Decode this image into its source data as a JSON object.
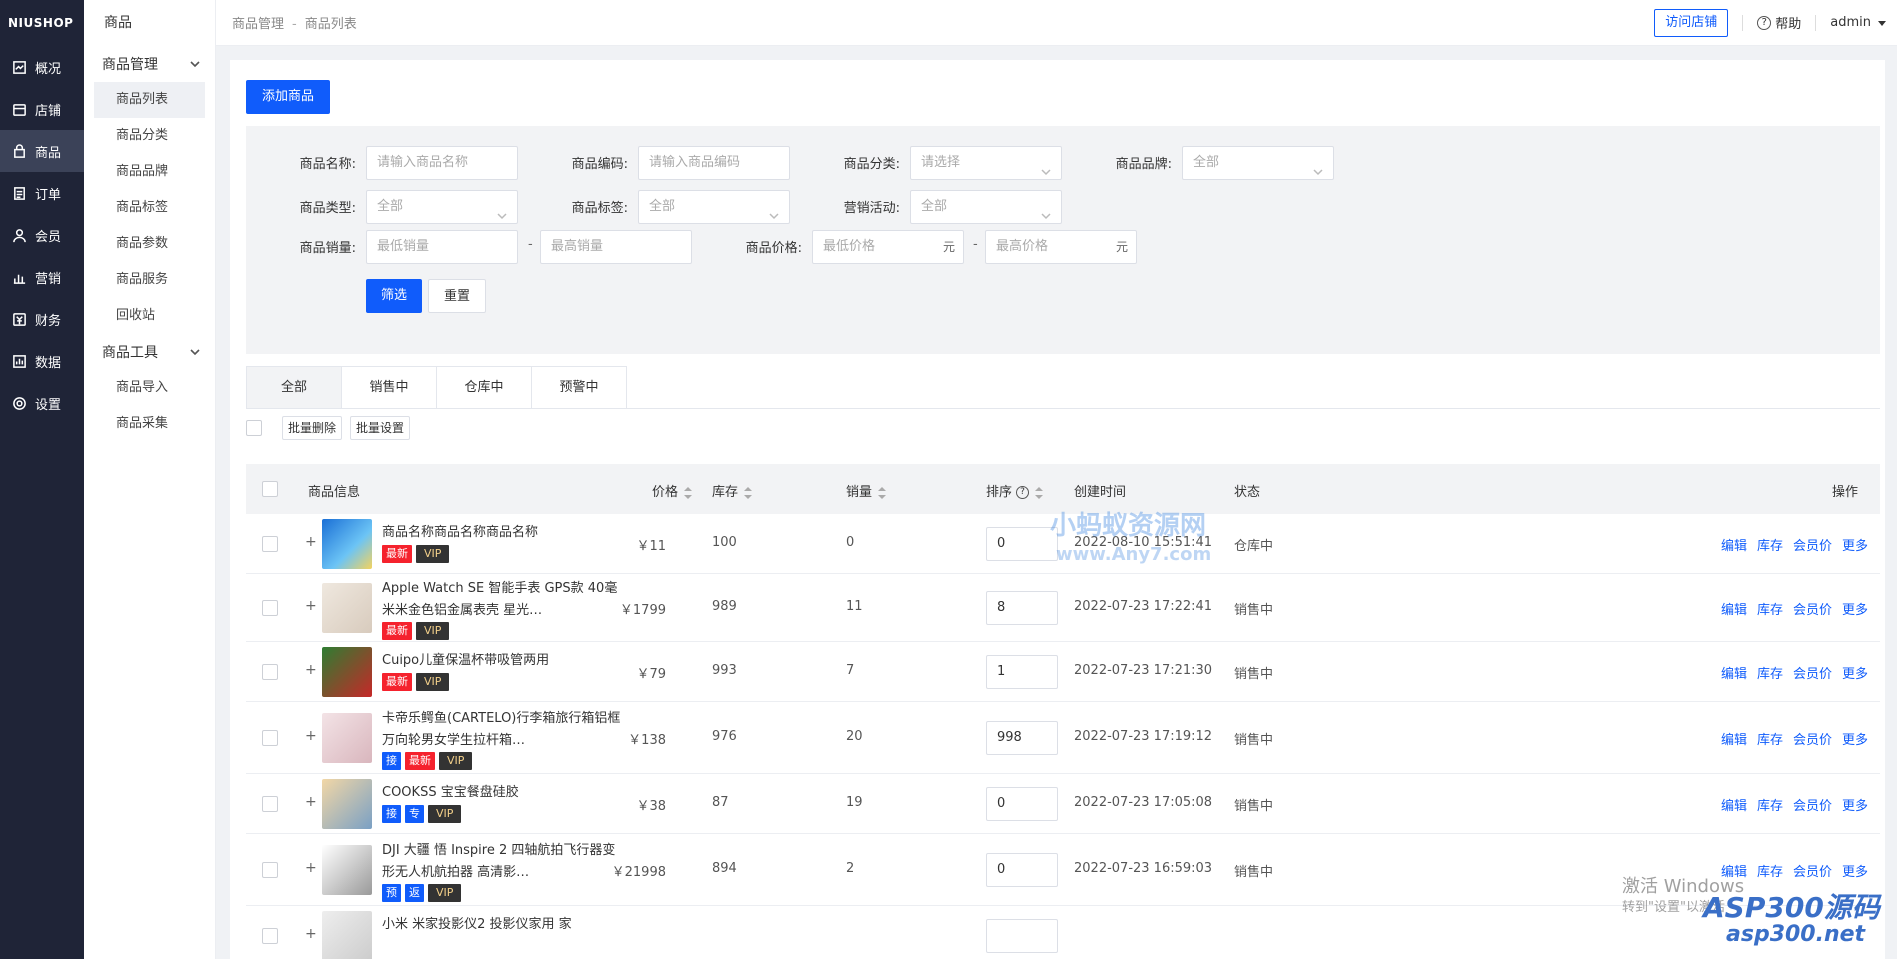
{
  "app": {
    "logo": "NIUSHOP"
  },
  "sidebar": {
    "items": [
      {
        "label": "概况",
        "icon": "dashboard-icon"
      },
      {
        "label": "店铺",
        "icon": "store-icon"
      },
      {
        "label": "商品",
        "icon": "goods-icon",
        "active": true
      },
      {
        "label": "订单",
        "icon": "order-icon"
      },
      {
        "label": "会员",
        "icon": "member-icon"
      },
      {
        "label": "营销",
        "icon": "marketing-icon"
      },
      {
        "label": "财务",
        "icon": "finance-icon"
      },
      {
        "label": "数据",
        "icon": "data-icon"
      },
      {
        "label": "设置",
        "icon": "settings-icon"
      }
    ]
  },
  "subnav": {
    "title": "商品",
    "group1": "商品管理",
    "group1_items": [
      "商品列表",
      "商品分类",
      "商品品牌",
      "商品标签",
      "商品参数",
      "商品服务",
      "回收站"
    ],
    "group2": "商品工具",
    "group2_items": [
      "商品导入",
      "商品采集"
    ]
  },
  "topbar": {
    "breadcrumb": [
      "商品管理",
      "商品列表"
    ],
    "breadcrumb_sep": "-",
    "visit_store": "访问店铺",
    "help": "帮助",
    "user": "admin"
  },
  "toolbar": {
    "add_goods": "添加商品"
  },
  "filter": {
    "name_label": "商品名称:",
    "name_placeholder": "请输入商品名称",
    "code_label": "商品编码:",
    "code_placeholder": "请输入商品编码",
    "category_label": "商品分类:",
    "category_value": "请选择",
    "brand_label": "商品品牌:",
    "brand_value": "全部",
    "type_label": "商品类型:",
    "type_value": "全部",
    "tag_label": "商品标签:",
    "tag_value": "全部",
    "promo_label": "营销活动:",
    "promo_value": "全部",
    "sales_label": "商品销量:",
    "sales_min": "最低销量",
    "sales_max": "最高销量",
    "price_label": "商品价格:",
    "price_min": "最低价格",
    "price_max": "最高价格",
    "unit": "元",
    "range_sep": "-",
    "submit": "筛选",
    "reset": "重置"
  },
  "tabs": [
    "全部",
    "销售中",
    "仓库中",
    "预警中"
  ],
  "batch": {
    "delete": "批量删除",
    "settings": "批量设置"
  },
  "table": {
    "headers": {
      "info": "商品信息",
      "price": "价格",
      "stock": "库存",
      "sales": "销量",
      "sort": "排序",
      "created": "创建时间",
      "status": "状态",
      "ops": "操作"
    },
    "ops": [
      "编辑",
      "库存",
      "会员价",
      "更多"
    ],
    "rows": [
      {
        "name": "商品名称商品名称商品名称",
        "badges": [
          "最新",
          "VIP"
        ],
        "price": "￥11",
        "stock": "100",
        "sales": "0",
        "sort": "0",
        "created": "2022-08-10 15:51:41",
        "status": "仓库中"
      },
      {
        "name": "Apple Watch SE 智能手表 GPS款 40毫米米金色铝金属表壳 星光…",
        "badges": [
          "最新",
          "VIP"
        ],
        "price": "￥1799",
        "stock": "989",
        "sales": "11",
        "sort": "8",
        "created": "2022-07-23 17:22:41",
        "status": "销售中"
      },
      {
        "name": "Cuipo儿童保温杯带吸管两用",
        "badges": [
          "最新",
          "VIP"
        ],
        "price": "￥79",
        "stock": "993",
        "sales": "7",
        "sort": "1",
        "created": "2022-07-23 17:21:30",
        "status": "销售中"
      },
      {
        "name": "卡帝乐鳄鱼(CARTELO)行李箱旅行箱铝框万向轮男女学生拉杆箱…",
        "badges": [
          "接",
          "最新",
          "VIP"
        ],
        "price": "￥138",
        "stock": "976",
        "sales": "20",
        "sort": "998",
        "created": "2022-07-23 17:19:12",
        "status": "销售中"
      },
      {
        "name": "COOKSS 宝宝餐盘硅胶",
        "badges": [
          "接",
          "专",
          "VIP"
        ],
        "price": "￥38",
        "stock": "87",
        "sales": "19",
        "sort": "0",
        "created": "2022-07-23 17:05:08",
        "status": "销售中"
      },
      {
        "name": "DJI 大疆 悟 Inspire 2 四轴航拍飞行器变形无人机航拍器 高清影…",
        "badges": [
          "预",
          "返",
          "VIP"
        ],
        "price": "￥21998",
        "stock": "894",
        "sales": "2",
        "sort": "0",
        "created": "2022-07-23 16:59:03",
        "status": "销售中"
      },
      {
        "name": "小米 米家投影仪2 投影仪家用 家",
        "badges": [],
        "price": "",
        "stock": "",
        "sales": "",
        "sort": "",
        "created": "",
        "status": ""
      }
    ]
  },
  "overlay": {
    "watermark": "小蚂蚁资源网",
    "watermark_url": "www.Any7.com",
    "activate_title": "激活 Windows",
    "activate_sub": "转到\"设置\"以激活",
    "asp_logo": "ASP300源码",
    "asp_url": "asp300.net"
  }
}
